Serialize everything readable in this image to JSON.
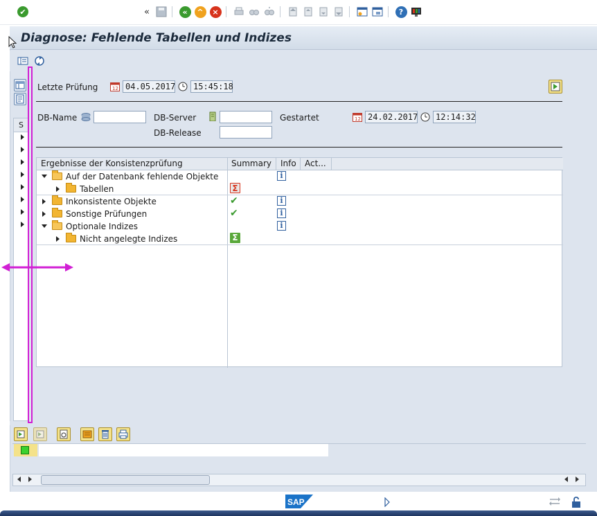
{
  "title": "Diagnose: Fehlende Tabellen und Indizes",
  "check_info": {
    "label": "Letzte Prüfung",
    "date": "04.05.2017",
    "time": "15:45:18"
  },
  "db_info": {
    "db_name_label": "DB-Name",
    "db_name_value": "",
    "db_server_label": "DB-Server",
    "db_server_value": "",
    "started_label": "Gestartet",
    "started_date": "24.02.2017",
    "started_time": "12:14:32",
    "db_release_label": "DB-Release",
    "db_release_value": ""
  },
  "dock": {
    "column_header": "S",
    "row_count": 8
  },
  "tree": {
    "columns": [
      "Ergebnisse der Konsistenzprüfung",
      "Summary",
      "Info",
      "Act..."
    ],
    "rows": [
      {
        "label": "Auf der Datenbank fehlende Objekte",
        "level": 0,
        "expanded": true,
        "summary": "",
        "info": true
      },
      {
        "label": "Tabellen",
        "level": 1,
        "expanded": false,
        "summary": "sigma-red-icon",
        "info": false
      },
      {
        "label": "Inkonsistente Objekte",
        "level": 0,
        "expanded": false,
        "summary": "check-icon",
        "info": true
      },
      {
        "label": "Sonstige Prüfungen",
        "level": 0,
        "expanded": false,
        "summary": "check-icon",
        "info": true
      },
      {
        "label": "Optionale Indizes",
        "level": 0,
        "expanded": true,
        "summary": "",
        "info": true
      },
      {
        "label": "Nicht angelegte Indizes",
        "level": 1,
        "expanded": false,
        "summary": "sigma-green-icon",
        "info": false
      }
    ]
  },
  "info_glyph": "i",
  "check_glyph": "✔",
  "sigma_glyph": "Σ",
  "message_status": "green",
  "colors": {
    "accent": "#d11fd4",
    "frame": "#dde4ee",
    "folder": "#f2b532",
    "ok_green": "#3a9a2e"
  }
}
